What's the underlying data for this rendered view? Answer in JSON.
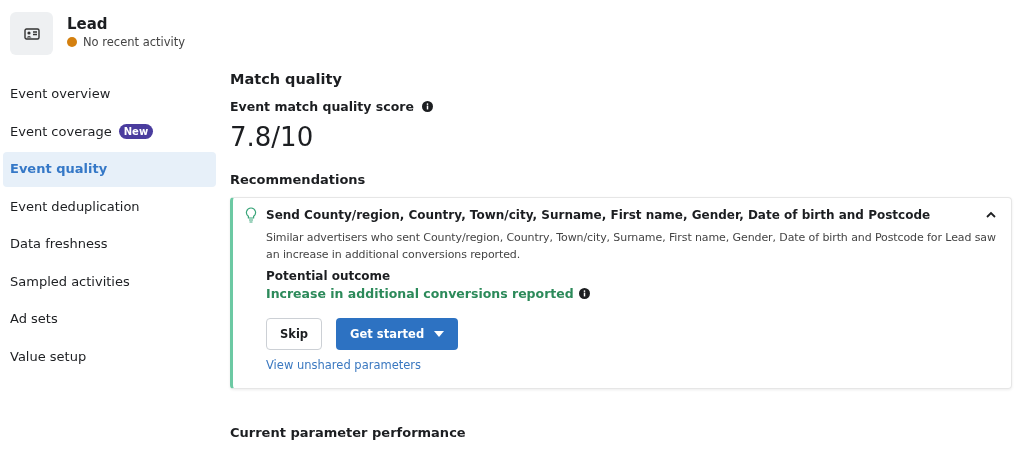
{
  "event": {
    "name": "Lead",
    "status": "No recent activity",
    "color": "#d4800f"
  },
  "sidebar": {
    "items": [
      {
        "label": "Event overview",
        "selected": false
      },
      {
        "label": "Event coverage",
        "badge": "New",
        "selected": false
      },
      {
        "label": "Event quality",
        "selected": true
      },
      {
        "label": "Event deduplication",
        "selected": false
      },
      {
        "label": "Data freshness",
        "selected": false
      },
      {
        "label": "Sampled activities",
        "selected": false
      },
      {
        "label": "Ad sets",
        "selected": false
      },
      {
        "label": "Value setup",
        "selected": false
      }
    ]
  },
  "main": {
    "title": "Match quality",
    "score_label": "Event match quality score",
    "score": "7.8/10",
    "recommendations_title": "Recommendations",
    "recommendation": {
      "title": "Send County/region, Country, Town/city, Surname, First name, Gender, Date of birth and Postcode",
      "expanded": true,
      "description": "Similar advertisers who sent County/region, Country, Town/city, Surname, First name, Gender, Date of birth and Postcode for Lead saw an increase in additional conversions reported.",
      "outcome_label": "Potential outcome",
      "outcome": "Increase in additional conversions reported",
      "buttons": [
        "Skip",
        "Get started"
      ],
      "link": "View unshared parameters"
    },
    "next_section": "Current parameter performance"
  }
}
